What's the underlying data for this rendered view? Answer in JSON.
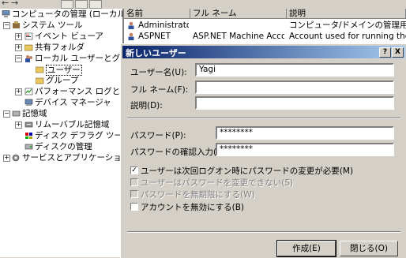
{
  "tree": {
    "items": [
      {
        "label": "コンピュータの管理 (ローカル)"
      },
      {
        "label": "システム ツール"
      },
      {
        "label": "イベント ビューア"
      },
      {
        "label": "共有フォルダ"
      },
      {
        "label": "ローカル ユーザーとグループ"
      },
      {
        "label": "ユーザー"
      },
      {
        "label": "グループ"
      },
      {
        "label": "パフォーマンス ログと警告"
      },
      {
        "label": "デバイス マネージャ"
      },
      {
        "label": "記憶域"
      },
      {
        "label": "リムーバブル記憶域"
      },
      {
        "label": "ディスク デフラグ ツール"
      },
      {
        "label": "ディスクの管理"
      },
      {
        "label": "サービスとアプリケーション"
      }
    ]
  },
  "list": {
    "columns": [
      "名前",
      "フル ネーム",
      "説明"
    ],
    "rows": [
      {
        "name": "Administrator",
        "fullname": "",
        "desc": "コンピュータ/ドメインの管理用 (ビル"
      },
      {
        "name": "ASPNET",
        "fullname": "ASP.NET Machine Account",
        "desc": "Account used for running the AS"
      }
    ]
  },
  "dialog": {
    "title": "新しいユーザー",
    "help_btn": "?",
    "close_btn": "X",
    "username_label": "ユーザー名(U):",
    "username_value": "Yagi",
    "fullname_label": "フル ネーム(F):",
    "fullname_value": "",
    "desc_label": "説明(D):",
    "desc_value": "",
    "password_label": "パスワード(P):",
    "password_value": "********",
    "confirm_label": "パスワードの確認入力(C):",
    "confirm_value": "********",
    "options": [
      {
        "label": "ユーザーは次回ログオン時にパスワードの変更が必要(M)",
        "checked": true,
        "enabled": true
      },
      {
        "label": "ユーザーはパスワードを変更できない(S)",
        "checked": false,
        "enabled": false
      },
      {
        "label": "パスワードを無期限にする(W)",
        "checked": false,
        "enabled": false
      },
      {
        "label": "アカウントを無効にする(B)",
        "checked": false,
        "enabled": true
      }
    ],
    "create_btn": "作成(E)",
    "close_label": "閉じる(O)"
  }
}
